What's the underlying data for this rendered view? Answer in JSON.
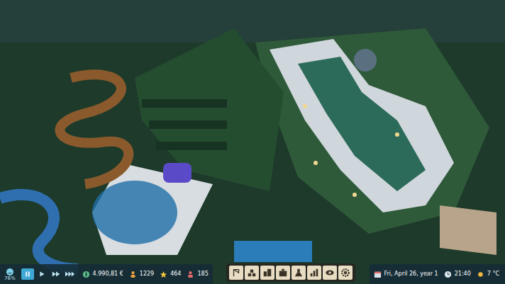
{
  "hud": {
    "happiness": {
      "reading": "76%"
    },
    "speed_controls": [
      {
        "kind": "pause",
        "selected": true
      },
      {
        "kind": "play",
        "selected": false
      },
      {
        "kind": "fast",
        "selected": false
      },
      {
        "kind": "faster",
        "selected": false
      }
    ],
    "stats": [
      {
        "kind": "money",
        "value": "4.990,81 €"
      },
      {
        "kind": "guests",
        "value": "1229"
      },
      {
        "kind": "rating",
        "value": "464"
      },
      {
        "kind": "staff",
        "value": "185"
      }
    ],
    "toolbar": [
      {
        "kind": "build"
      },
      {
        "kind": "paths"
      },
      {
        "kind": "scenery"
      },
      {
        "kind": "shops"
      },
      {
        "kind": "research"
      },
      {
        "kind": "stats"
      },
      {
        "kind": "view"
      },
      {
        "kind": "settings"
      }
    ],
    "status": [
      {
        "kind": "date",
        "value": "Fri, April 26, year 1"
      },
      {
        "kind": "time",
        "value": "21:40"
      },
      {
        "kind": "temperature",
        "value": "7 °C"
      }
    ]
  }
}
